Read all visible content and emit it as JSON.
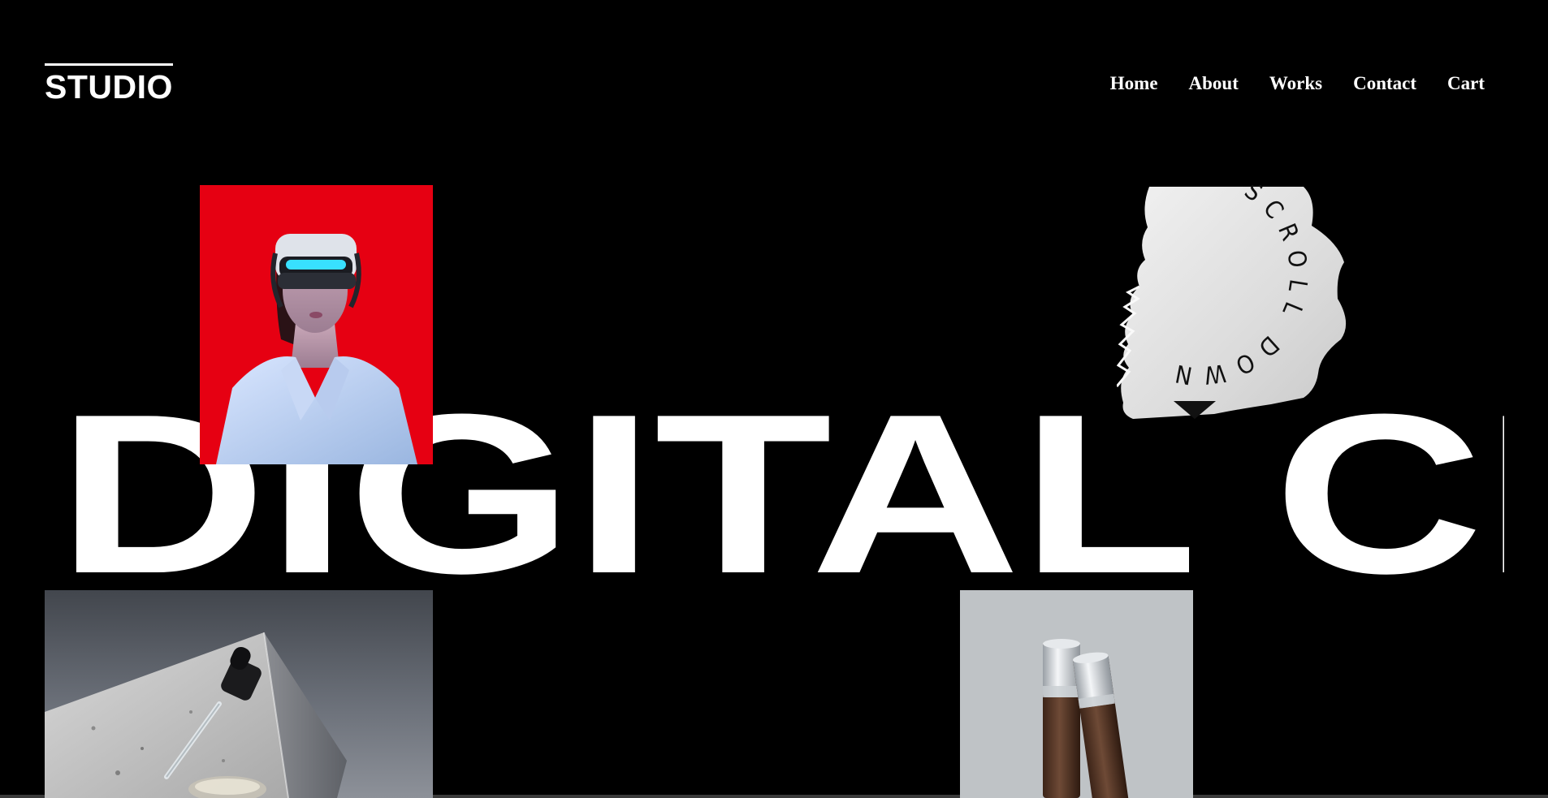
{
  "header": {
    "logo_text": "STUDIO",
    "nav": [
      {
        "label": "Home"
      },
      {
        "label": "About"
      },
      {
        "label": "Works"
      },
      {
        "label": "Contact"
      },
      {
        "label": "Cart"
      }
    ]
  },
  "hero": {
    "title": "DIGITAL CR"
  },
  "scroll_badge": {
    "text": "SCROLL DOWN SCR"
  },
  "images": {
    "vr": {
      "alt": "woman wearing vr headset",
      "bg": "#e60012"
    },
    "dropper": {
      "alt": "dropper bottle on concrete"
    },
    "tubes": {
      "alt": "cosmetic tubes",
      "bg": "#bfc3c6"
    },
    "scroll": {
      "alt": "torn paper scroll badge"
    }
  },
  "colors": {
    "background": "#000000",
    "text": "#ffffff",
    "accent_red": "#e60012"
  }
}
